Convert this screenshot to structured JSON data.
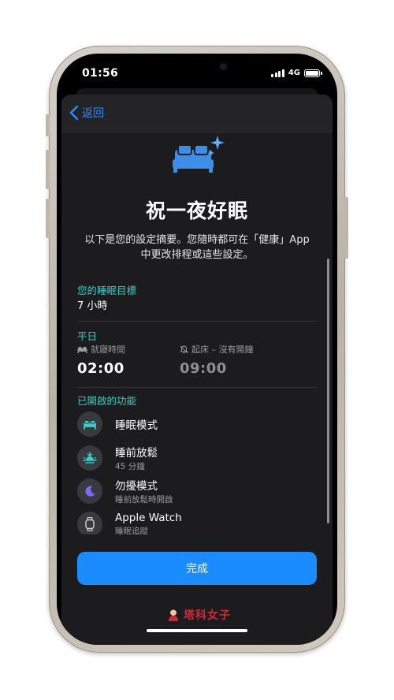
{
  "status_bar": {
    "time": "01:56",
    "network": "4G"
  },
  "nav": {
    "back_label": "返回"
  },
  "header": {
    "title": "祝一夜好眠",
    "description": "以下是您的設定摘要。您隨時都可在「健康」App 中更改排程或這些設定。"
  },
  "sleep_goal": {
    "label": "您的睡眠目標",
    "value": "7 小時"
  },
  "schedule": {
    "label": "平日",
    "bedtime": {
      "label": "就寢時間",
      "value": "02:00",
      "icon": "bed-icon"
    },
    "wake": {
      "label": "起床 – 沒有鬧鐘",
      "value": "09:00",
      "icon": "bell-slash-icon"
    }
  },
  "features": {
    "label": "已開啟的功能",
    "items": [
      {
        "title": "睡眠模式",
        "subtitle": "",
        "icon": "bed-icon"
      },
      {
        "title": "睡前放鬆",
        "subtitle": "45 分鐘",
        "icon": "sunset-icon"
      },
      {
        "title": "勿擾模式",
        "subtitle": "睡前放鬆時開啟",
        "icon": "moon-icon"
      },
      {
        "title": "Apple Watch",
        "subtitle": "睡眠追蹤",
        "icon": "watch-icon"
      }
    ]
  },
  "actions": {
    "done_label": "完成"
  },
  "watermark": {
    "text": "塔科女子"
  },
  "colors": {
    "accent_blue": "#1a8cff",
    "teal": "#30d0c6",
    "bed_blue": "#3c8ee6",
    "background": "#1c1c1e"
  }
}
